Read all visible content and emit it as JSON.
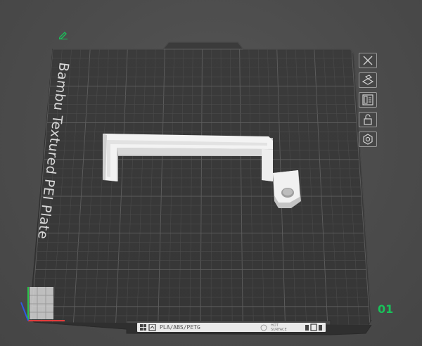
{
  "plate": {
    "name": "Bambu Textured PEI Plate",
    "number": "01",
    "filament_label": "PLA/ABS/PETG",
    "hot_surface_line1": "HOT",
    "hot_surface_line2": "SURFACE"
  },
  "toolbar": {
    "buttons": [
      {
        "name": "close-plate-button",
        "icon": "close-icon"
      },
      {
        "name": "auto-orient-button",
        "icon": "orient-icon"
      },
      {
        "name": "arrange-button",
        "icon": "arrange-icon"
      },
      {
        "name": "lock-plate-button",
        "icon": "lock-icon"
      },
      {
        "name": "plate-settings-button",
        "icon": "gear-icon"
      }
    ]
  },
  "colors": {
    "accent_green": "#19c25a",
    "plate_dark": "#3c3c3c",
    "grid_line": "#5a5a5a",
    "model_white": "#f2f2f2"
  }
}
